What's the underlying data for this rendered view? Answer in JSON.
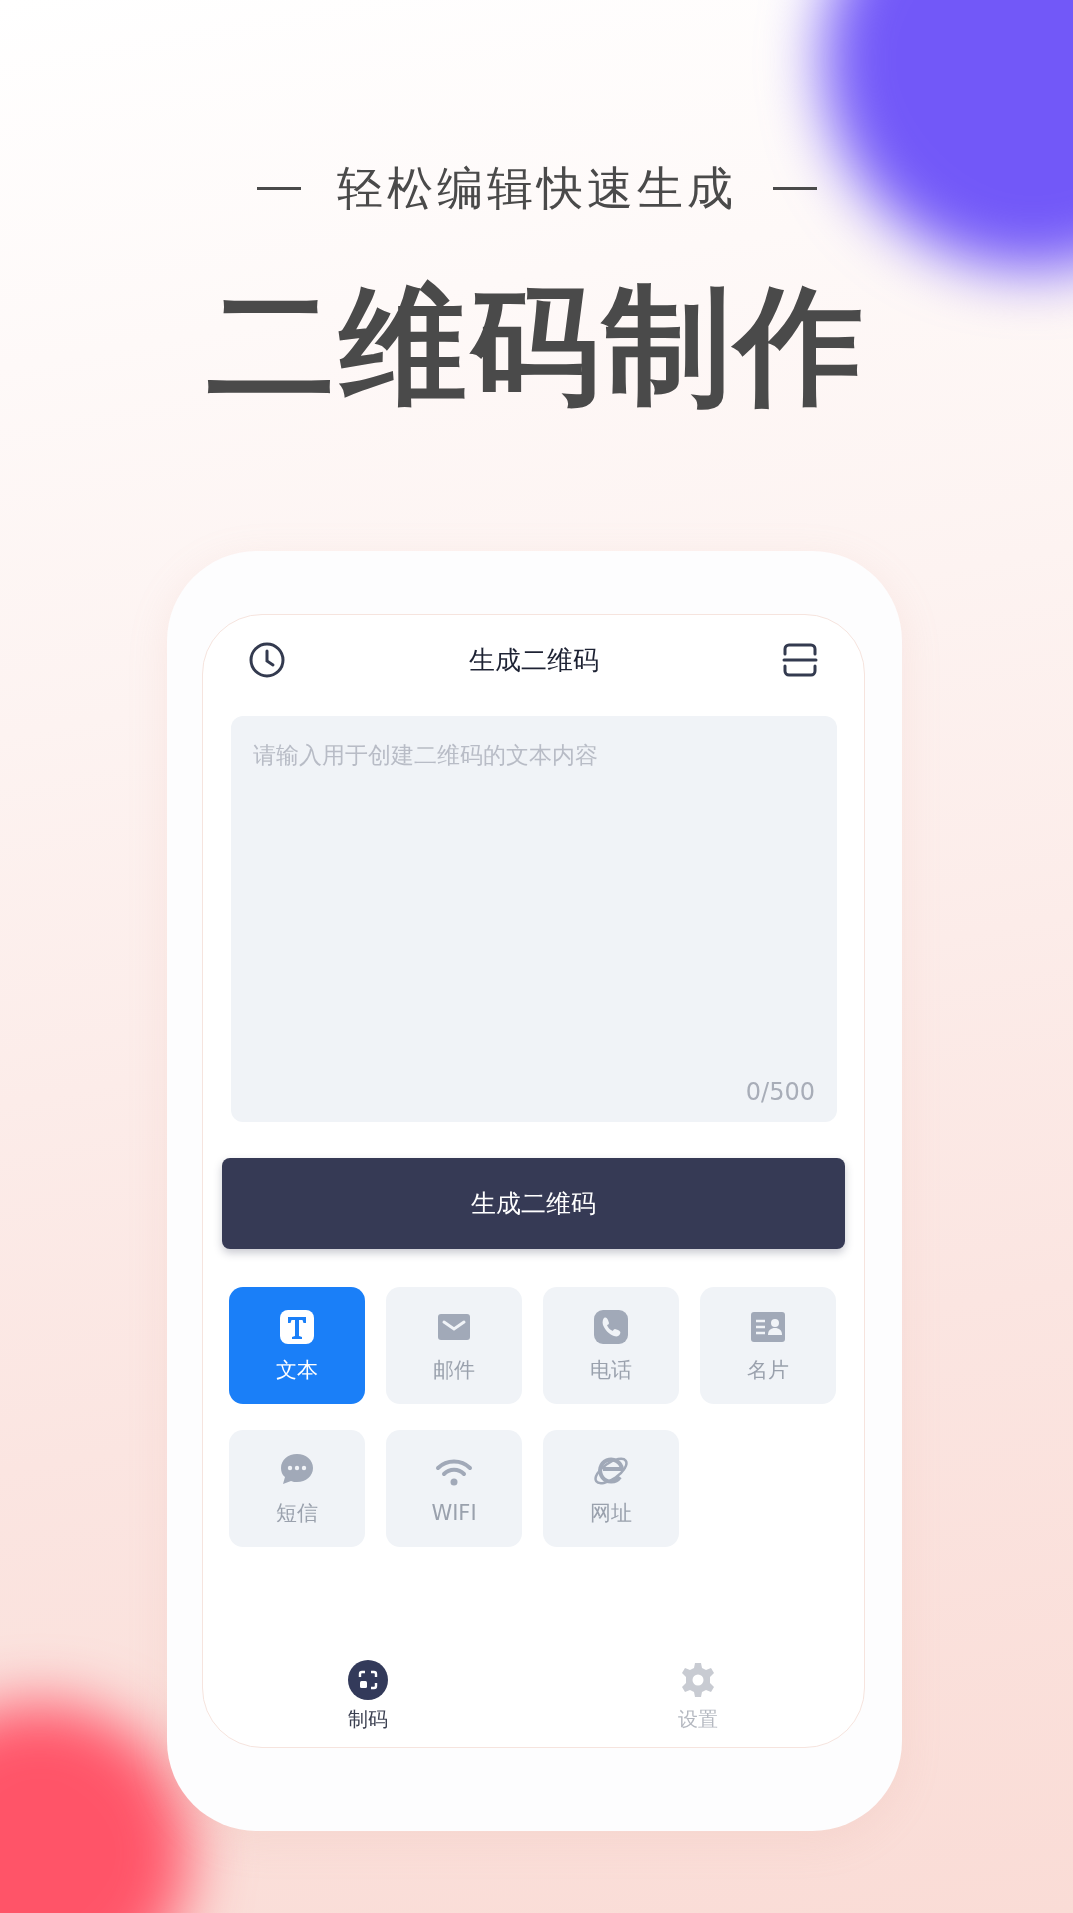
{
  "tagline": "轻松编辑快速生成",
  "headline": "二维码制作",
  "screen": {
    "header": {
      "title": "生成二维码"
    },
    "input": {
      "placeholder": "请输入用于创建二维码的文本内容",
      "counter": "0/500"
    },
    "generate_button": "生成二维码",
    "types": [
      {
        "kind": "text",
        "label": "文本",
        "selected": true
      },
      {
        "kind": "email",
        "label": "邮件",
        "selected": false
      },
      {
        "kind": "phone",
        "label": "电话",
        "selected": false
      },
      {
        "kind": "card",
        "label": "名片",
        "selected": false
      },
      {
        "kind": "sms",
        "label": "短信",
        "selected": false
      },
      {
        "kind": "wifi",
        "label": "WIFI",
        "selected": false
      },
      {
        "kind": "web",
        "label": "网址",
        "selected": false
      }
    ],
    "tabs": [
      {
        "kind": "make",
        "label": "制码",
        "selected": true
      },
      {
        "kind": "settings",
        "label": "设置",
        "selected": false
      }
    ]
  }
}
